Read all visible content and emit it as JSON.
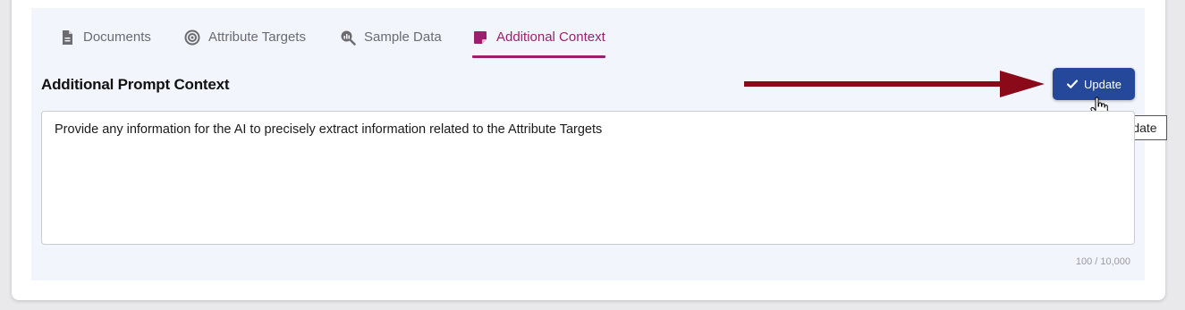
{
  "tabs": [
    {
      "label": "Documents",
      "icon": "document-icon",
      "active": false
    },
    {
      "label": "Attribute Targets",
      "icon": "target-icon",
      "active": false
    },
    {
      "label": "Sample Data",
      "icon": "search-chart-icon",
      "active": false
    },
    {
      "label": "Additional Context",
      "icon": "sticky-note-icon",
      "active": true
    }
  ],
  "section": {
    "title": "Additional Prompt Context"
  },
  "update_button": {
    "label": "Update",
    "tooltip": "Update"
  },
  "prompt_context": {
    "value": "Provide any information for the AI to precisely extract information related to the Attribute Targets",
    "char_count": "100 / 10,000"
  },
  "colors": {
    "accent": "#9c1f6e",
    "button": "#25489a",
    "arrow": "#8b0a1a"
  }
}
